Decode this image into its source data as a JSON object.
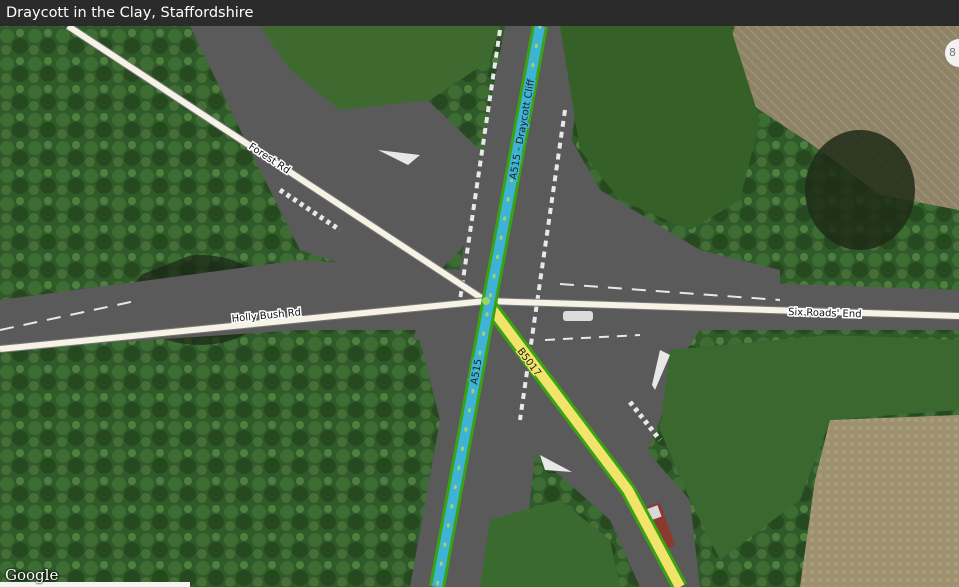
{
  "title": "Draycott in the Clay, Staffordshire",
  "zoom_badge": "8",
  "attribution": "Google",
  "roads": {
    "forest_rd": "Forest Rd",
    "holly_bush_rd": "Holly Bush Rd",
    "six_roads_end": "Six Roads' End",
    "a515_draycott_cliff": "A515 - Draycott Cliff",
    "a515": "A515",
    "b5017": "B5017"
  },
  "colors": {
    "trunk_road": "#3fb3d6",
    "secondary_road": "#f2e36b",
    "road_casing": "#3aa313",
    "minor_road": "#f6f3e6",
    "titlebar": "#2b2b2b"
  }
}
